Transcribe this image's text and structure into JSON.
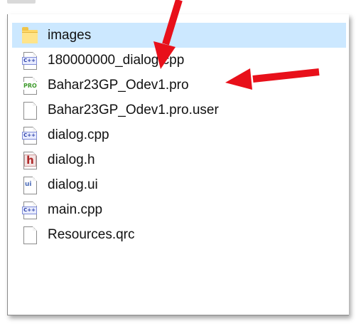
{
  "files": [
    {
      "name": "images",
      "icon": "folder-icon",
      "selected": true
    },
    {
      "name": "180000000_dialog.cpp",
      "icon": "cpp-file-icon",
      "badge": "C++"
    },
    {
      "name": "Bahar23GP_Odev1.pro",
      "icon": "pro-file-icon",
      "badge": "PRO"
    },
    {
      "name": "Bahar23GP_Odev1.pro.user",
      "icon": "generic-file-icon"
    },
    {
      "name": "dialog.cpp",
      "icon": "cpp-file-icon",
      "badge": "C++"
    },
    {
      "name": "dialog.h",
      "icon": "header-file-icon",
      "badge": "h"
    },
    {
      "name": "dialog.ui",
      "icon": "ui-file-icon",
      "badge": "ui"
    },
    {
      "name": "main.cpp",
      "icon": "cpp-file-icon",
      "badge": "C++"
    },
    {
      "name": "Resources.qrc",
      "icon": "generic-file-icon"
    }
  ],
  "colors": {
    "selection": "#cce8ff",
    "arrow": "#e8101a",
    "cpp_badge": "#2b3fa8",
    "pro_badge": "#3d9a2b",
    "h_badge": "#b02a2a"
  }
}
